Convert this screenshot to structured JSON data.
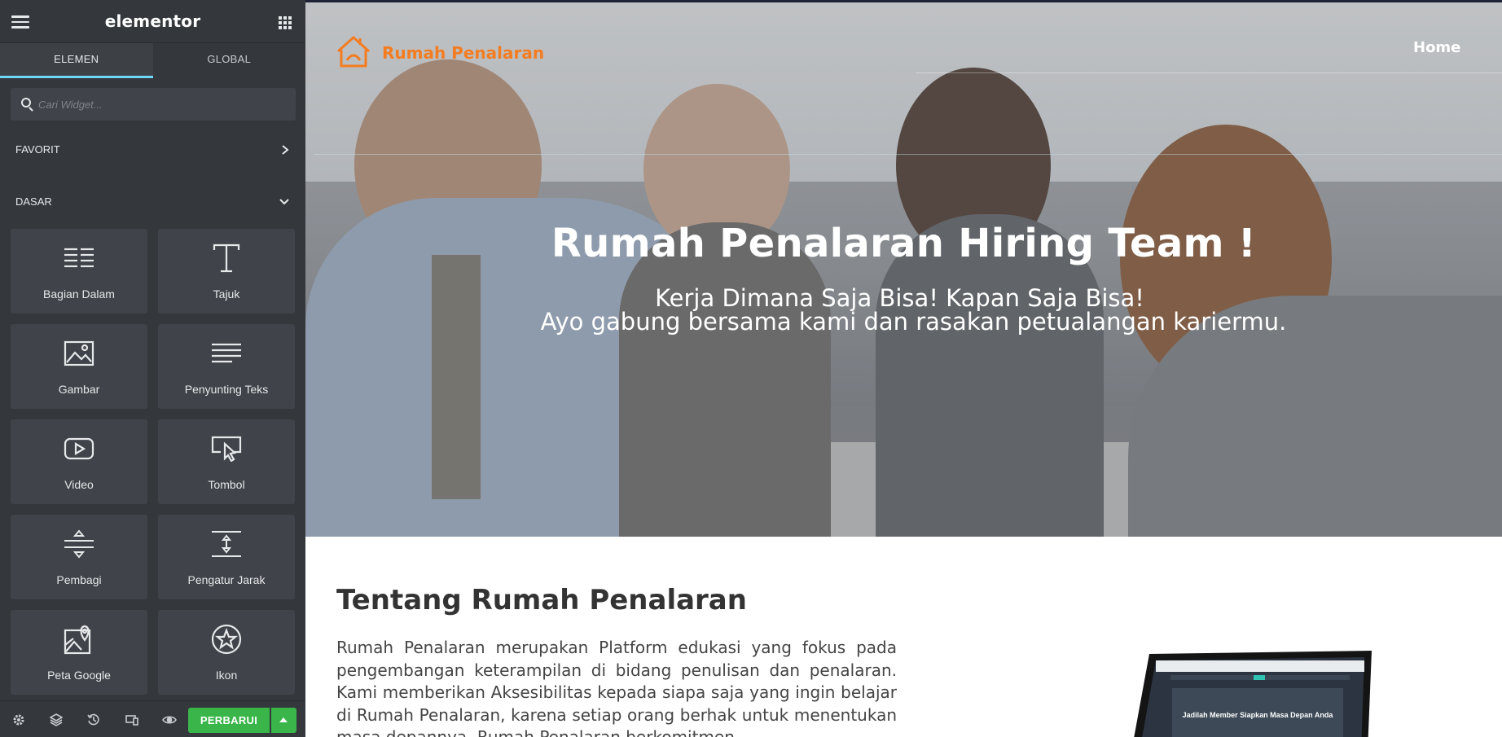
{
  "sidebar": {
    "brand": "elementor",
    "tabs": [
      {
        "label": "ELEMEN",
        "active": true
      },
      {
        "label": "GLOBAL",
        "active": false
      }
    ],
    "search_placeholder": "Cari Widget...",
    "sections": [
      {
        "title": "FAVORIT",
        "state": "collapsed"
      },
      {
        "title": "DASAR",
        "state": "expanded"
      }
    ],
    "widgets": [
      {
        "label": "Bagian Dalam",
        "icon": "inner-section-icon"
      },
      {
        "label": "Tajuk",
        "icon": "heading-icon"
      },
      {
        "label": "Gambar",
        "icon": "image-icon"
      },
      {
        "label": "Penyunting Teks",
        "icon": "text-editor-icon"
      },
      {
        "label": "Video",
        "icon": "video-icon"
      },
      {
        "label": "Tombol",
        "icon": "button-icon"
      },
      {
        "label": "Pembagi",
        "icon": "divider-icon"
      },
      {
        "label": "Pengatur Jarak",
        "icon": "spacer-icon"
      },
      {
        "label": "Peta Google",
        "icon": "google-maps-icon"
      },
      {
        "label": "Ikon",
        "icon": "star-icon"
      }
    ],
    "footer": {
      "publish_label": "PERBARUI",
      "icons": [
        "settings-icon",
        "navigator-icon",
        "history-icon",
        "responsive-icon",
        "preview-icon"
      ]
    },
    "colors": {
      "panel": "#34383c",
      "widget": "#404349",
      "accent": "#71d7f7",
      "publish": "#39b54a"
    }
  },
  "page": {
    "logo_text": "Rumah Penalaran",
    "nav": [
      "Home"
    ],
    "hero": {
      "title": "Rumah Penalaran Hiring Team !",
      "subtitle_line1": "Kerja Dimana Saja Bisa! Kapan Saja Bisa!",
      "subtitle_line2": "Ayo gabung bersama kami dan rasakan petualangan kariermu."
    },
    "about": {
      "title": "Tentang Rumah Penalaran",
      "text": "Rumah Penalaran merupakan Platform edukasi yang fokus pada pengembangan keterampilan di bidang penulisan dan penalaran. Kami memberikan Aksesibilitas kepada siapa saja yang ingin belajar di Rumah Penalaran, karena setiap orang berhak untuk menentukan masa depannya. Rumah Penalaran berkomitmen"
    },
    "laptop_screen_headline": "Jadilah Member Siapkan Masa Depan Anda",
    "colors": {
      "logo": "#f47c20",
      "heading": "#333333"
    }
  }
}
